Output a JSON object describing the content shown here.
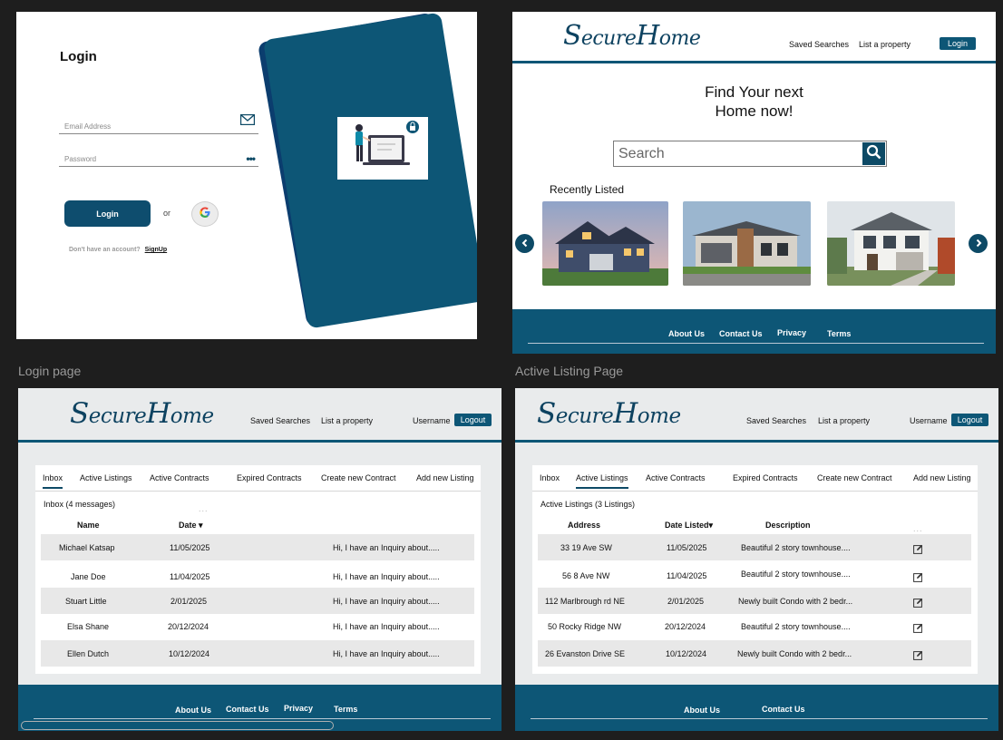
{
  "frame_labels": {
    "login": "Login page",
    "listing": "Active Listing Page"
  },
  "login": {
    "title": "Login",
    "email_placeholder": "Email Address",
    "password_placeholder": "Password",
    "password_mask": "•••",
    "login_button": "Login",
    "or": "or",
    "no_account": "Don't have an account?",
    "signup": "SignUp"
  },
  "brand": {
    "logo_first": "S",
    "logo_mid": "ecure",
    "logo_cap": "H",
    "logo_end": "ome"
  },
  "home": {
    "nav": [
      "Saved Searches",
      "List a property"
    ],
    "login_button": "Login",
    "hero_line1": "Find Your next",
    "hero_line2": "Home now!",
    "search_placeholder": "Search",
    "recent_label": "Recently Listed",
    "footer": [
      "About Us",
      "Contact Us",
      "Privacy",
      "Terms"
    ]
  },
  "dash_header": {
    "nav": [
      "Saved Searches",
      "List a property"
    ],
    "username": "Username",
    "logout": "Logout"
  },
  "inbox": {
    "tabs": [
      "Inbox",
      "Active Listings",
      "Active Contracts",
      "Expired Contracts",
      "Create new Contract",
      "Add new Listing"
    ],
    "subtitle": "Inbox (4 messages)",
    "dots": "...",
    "headers": [
      "Name",
      "Date ▾"
    ],
    "rows": [
      {
        "name": "Michael Katsap",
        "date": "11/05/2025",
        "msg": "Hi, I have an Inquiry about....."
      },
      {
        "name": "Jane Doe",
        "date": "11/04/2025",
        "msg": "Hi, I have an Inquiry about....."
      },
      {
        "name": "Stuart Little",
        "date": "2/01/2025",
        "msg": "Hi, I have an Inquiry about....."
      },
      {
        "name": "Elsa Shane",
        "date": "20/12/2024",
        "msg": "Hi, I have an Inquiry about....."
      },
      {
        "name": "Ellen Dutch",
        "date": "10/12/2024",
        "msg": "Hi, I have an Inquiry about....."
      }
    ],
    "footer": [
      "About Us",
      "Contact Us",
      "Privacy",
      "Terms"
    ]
  },
  "listings": {
    "tabs": [
      "Inbox",
      "Active Listings",
      "Active Contracts",
      "Expired Contracts",
      "Create new Contract",
      "Add new Listing"
    ],
    "subtitle": "Active Listings (3 Listings)",
    "dots": "...",
    "headers": [
      "Address",
      "Date Listed▾",
      "Description"
    ],
    "rows": [
      {
        "address": "33 19 Ave SW",
        "date": "11/05/2025",
        "desc": "Beautiful 2 story townhouse...."
      },
      {
        "address": "56 8 Ave NW",
        "date": "11/04/2025",
        "desc": "Beautiful 2 story townhouse...."
      },
      {
        "address": "112 Marlbrough rd NE",
        "date": "2/01/2025",
        "desc": "Newly built Condo with 2 bedr..."
      },
      {
        "address": "50 Rocky Ridge NW",
        "date": "20/12/2024",
        "desc": "Beautiful 2 story townhouse...."
      },
      {
        "address": "26 Evanston Drive SE",
        "date": "10/12/2024",
        "desc": "Newly built Condo with 2 bedr..."
      }
    ],
    "footer": [
      "About Us",
      "Contact Us"
    ]
  },
  "icons": [
    "mail-icon",
    "password-dots-icon",
    "google-icon",
    "search-icon",
    "chevron-left-icon",
    "chevron-right-icon",
    "edit-icon",
    "lock-icon"
  ],
  "colors": {
    "primary": "#0d5676",
    "dark_primary": "#0b3d6e",
    "canvas": "#1e1e1e",
    "dash_bg": "#e9ebec",
    "row_shade": "#e8e8e8"
  }
}
